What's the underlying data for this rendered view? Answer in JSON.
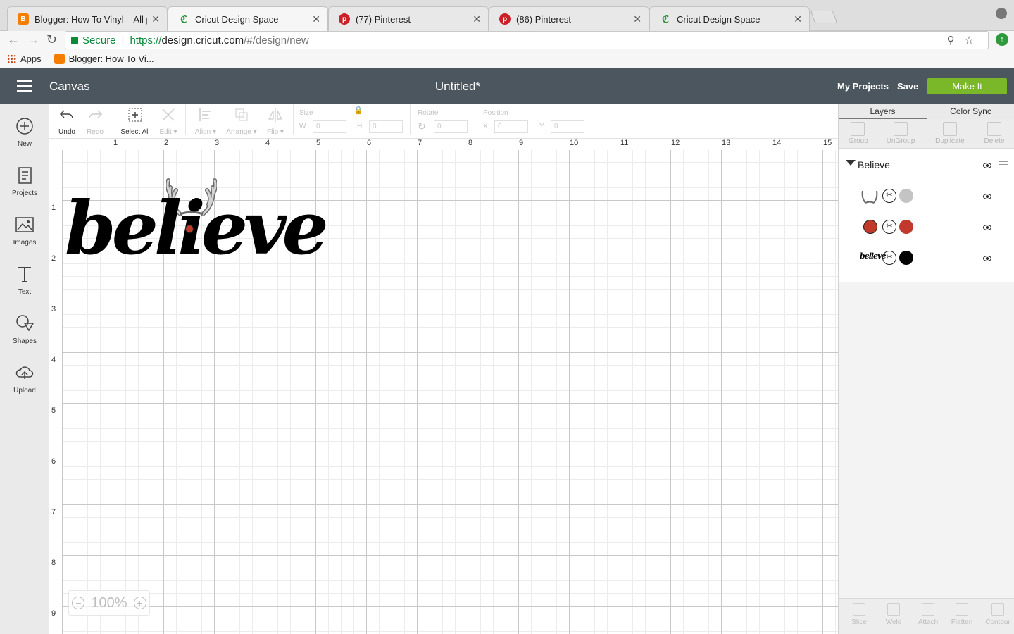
{
  "browser": {
    "tabs": [
      {
        "title": "Blogger: How To Vinyl – All p",
        "favicon": "blogger-icon",
        "color": "#f57d00",
        "active": false
      },
      {
        "title": "Cricut Design Space",
        "favicon": "cricut-icon",
        "color": "#2f9a3b",
        "active": true
      },
      {
        "title": "(77) Pinterest",
        "favicon": "pinterest-icon",
        "color": "#cb2027",
        "active": false
      },
      {
        "title": "(86) Pinterest",
        "favicon": "pinterest-icon",
        "color": "#cb2027",
        "active": false
      },
      {
        "title": "Cricut Design Space",
        "favicon": "cricut-icon",
        "color": "#2f9a3b",
        "active": false
      }
    ],
    "secure_label": "Secure",
    "url_scheme": "https://",
    "url_host": "design.cricut.com",
    "url_rest": "/#/design/new",
    "bookmarks": {
      "apps": "Apps",
      "blogger": "Blogger: How To Vi..."
    }
  },
  "header": {
    "app_title": "Canvas",
    "doc_title": "Untitled*",
    "my_projects": "My Projects",
    "save": "Save",
    "make_it": "Make It",
    "make_it_color": "#7ab829",
    "bg_color": "#4c565f"
  },
  "sidebar": [
    {
      "label": "New",
      "icon": "plus-circle-icon"
    },
    {
      "label": "Projects",
      "icon": "projects-icon"
    },
    {
      "label": "Images",
      "icon": "image-icon"
    },
    {
      "label": "Text",
      "icon": "text-icon"
    },
    {
      "label": "Shapes",
      "icon": "shapes-icon"
    },
    {
      "label": "Upload",
      "icon": "upload-icon"
    }
  ],
  "edit_bar": {
    "undo": "Undo",
    "redo": "Redo",
    "select_all": "Select All",
    "edit": "Edit",
    "align": "Align",
    "arrange": "Arrange",
    "flip": "Flip",
    "size": "Size",
    "w": "W",
    "h": "H",
    "rotate": "Rotate",
    "position": "Position",
    "x": "X",
    "y": "Y",
    "zero": "0"
  },
  "canvas": {
    "ruler_top": [
      "1",
      "2",
      "3",
      "4",
      "5",
      "6",
      "7",
      "8",
      "9",
      "10",
      "11",
      "12",
      "13",
      "14",
      "15"
    ],
    "ruler_left": [
      "1",
      "2",
      "3",
      "4",
      "5",
      "6",
      "7",
      "8",
      "9"
    ],
    "design_text": "believe",
    "nose_color": "#c0392b",
    "zoom": "100%"
  },
  "panel": {
    "tabs": [
      "Layers",
      "Color Sync"
    ],
    "tools": [
      "Group",
      "UnGroup",
      "Duplicate",
      "Delete"
    ],
    "group_name": "Believe",
    "layers": [
      {
        "name": "antlers",
        "color": "#c4c4c4"
      },
      {
        "name": "nose",
        "color": "#c0392b"
      },
      {
        "name": "believe",
        "color": "#000000"
      }
    ],
    "bottom_tools": [
      "Slice",
      "Weld",
      "Attach",
      "Flatten",
      "Contour"
    ]
  }
}
